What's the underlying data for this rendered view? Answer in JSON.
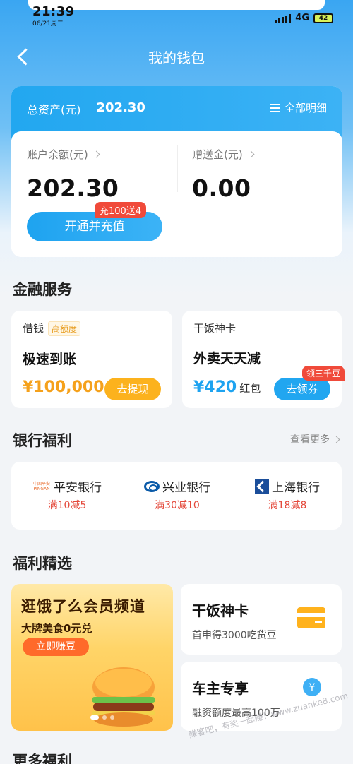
{
  "status": {
    "time": "21:39",
    "date": "06/21周二",
    "network": "4G",
    "battery": "42"
  },
  "nav": {
    "title": "我的钱包"
  },
  "assets": {
    "total_label": "总资产(元)",
    "total_value": "202.30",
    "detail_label": "全部明细",
    "balance_label": "账户余额(元)",
    "balance_value": "202.30",
    "gift_label": "赠送金(元)",
    "gift_value": "0.00",
    "recharge_button": "开通并充值",
    "recharge_promo": "充100送4"
  },
  "finance": {
    "title": "金融服务",
    "loan": {
      "tag": "借钱",
      "badge": "高额度",
      "headline": "极速到账",
      "amount": "¥100,000",
      "button": "去提现"
    },
    "card": {
      "tag": "干饭神卡",
      "headline": "外卖天天减",
      "amount": "¥420",
      "unit": "红包",
      "button": "去领券",
      "promo": "领三千豆"
    }
  },
  "bank": {
    "title": "银行福利",
    "see_more": "查看更多",
    "logo_pingan": "中国平安 PINGAN",
    "items": [
      {
        "name": "平安银行",
        "offer": "满10减5"
      },
      {
        "name": "兴业银行",
        "offer": "满30减10"
      },
      {
        "name": "上海银行",
        "offer": "满18减8"
      }
    ]
  },
  "benefits": {
    "title": "福利精选",
    "banner": {
      "headline": "逛饿了么会员频道",
      "sub": "大牌美食0元兑",
      "cta": "立即赚豆"
    },
    "card1": {
      "title": "干饭神卡",
      "sub": "首申得3000吃货豆"
    },
    "card2": {
      "title": "车主专享",
      "sub": "融资额度最高100万"
    }
  },
  "more": {
    "title": "更多福利"
  },
  "watermark": "赚客吧，有奖一起赚！www.zuanke8.com"
}
